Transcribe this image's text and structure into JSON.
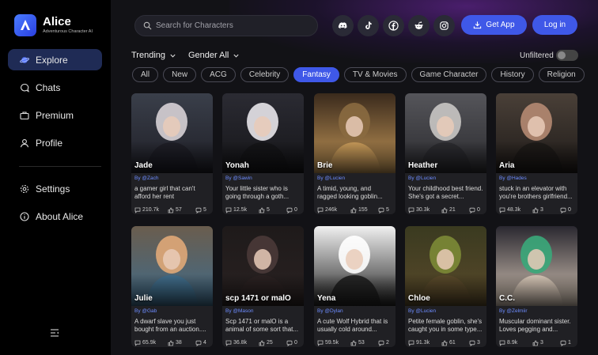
{
  "app": {
    "title": "Alice",
    "subtitle": "Adventurous Character AI"
  },
  "sidebar": {
    "items": [
      {
        "label": "Explore",
        "icon": "planet-icon"
      },
      {
        "label": "Chats",
        "icon": "chat-bubble-icon"
      },
      {
        "label": "Premium",
        "icon": "briefcase-icon"
      },
      {
        "label": "Profile",
        "icon": "user-icon"
      },
      {
        "label": "Settings",
        "icon": "gear-icon"
      },
      {
        "label": "About Alice",
        "icon": "info-icon"
      }
    ]
  },
  "header": {
    "search_placeholder": "Search for Characters",
    "social": [
      "discord-icon",
      "tiktok-icon",
      "facebook-icon",
      "reddit-icon",
      "instagram-icon"
    ],
    "get_app": "Get App",
    "login": "Log in"
  },
  "filters": {
    "sort": "Trending",
    "gender": "Gender All",
    "unfiltered": "Unfiltered"
  },
  "tags": [
    "All",
    "New",
    "ACG",
    "Celebrity",
    "Fantasy",
    "TV & Movies",
    "Game Character",
    "History",
    "Religion"
  ],
  "active_tag": "Fantasy",
  "colors": {
    "accent": "#3f58e8",
    "creator": "#6d8cff",
    "active_nav": "#1f2b55"
  },
  "cards": [
    {
      "name": "Jade",
      "by": "By @Zach",
      "desc": "a gamer girl that can't afford her rent",
      "chats": "210.7k",
      "likes": "57",
      "comments": "5"
    },
    {
      "name": "Yonah",
      "by": "By @Sawin",
      "desc": "Your little sister who is going through a goth...",
      "chats": "12.5k",
      "likes": "5",
      "comments": "0"
    },
    {
      "name": "Brie",
      "by": "By @Lucien",
      "desc": "A timid, young, and ragged looking goblin...",
      "chats": "246k",
      "likes": "155",
      "comments": "5"
    },
    {
      "name": "Heather",
      "by": "By @Lucien",
      "desc": "Your childhood best friend. She's got a secret...",
      "chats": "30.3k",
      "likes": "21",
      "comments": "0"
    },
    {
      "name": "Aria",
      "by": "By @Hades",
      "desc": "stuck in an elevator with you're brothers girlfriend...",
      "chats": "48.3k",
      "likes": "3",
      "comments": "0"
    },
    {
      "name": "Julie",
      "by": "By @Gab",
      "desc": "A dwarf slave you just bought from an auction....",
      "chats": "65.9k",
      "likes": "38",
      "comments": "4"
    },
    {
      "name": "scp 1471 or malO",
      "by": "By @Mason",
      "desc": "Scp 1471 or malO is a animal of some sort that...",
      "chats": "36.8k",
      "likes": "25",
      "comments": "0"
    },
    {
      "name": "Yena",
      "by": "By @Dylan",
      "desc": "A cute Wolf Hybrid that is usually cold around...",
      "chats": "59.5k",
      "likes": "53",
      "comments": "2"
    },
    {
      "name": "Chloe",
      "by": "By @Lucien",
      "desc": "Petite female goblin, she's caught you in some type...",
      "chats": "91.3k",
      "likes": "61",
      "comments": "3"
    },
    {
      "name": "C.C.",
      "by": "By @Zelmiir",
      "desc": "Muscular dominant sister. Loves pegging and...",
      "chats": "8.9k",
      "likes": "3",
      "comments": "1"
    }
  ]
}
